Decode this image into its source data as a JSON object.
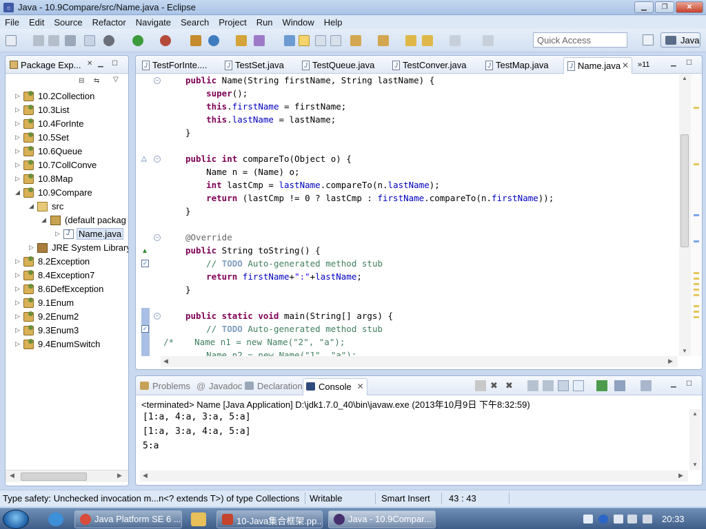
{
  "window": {
    "title": "Java - 10.9Compare/src/Name.java - Eclipse"
  },
  "menu": [
    "File",
    "Edit",
    "Source",
    "Refactor",
    "Navigate",
    "Search",
    "Project",
    "Run",
    "Window",
    "Help"
  ],
  "quick_access": {
    "placeholder": "Quick Access"
  },
  "perspective": {
    "label": "Java"
  },
  "package_explorer": {
    "title": "Package Exp...",
    "tree": [
      {
        "label": "10.2Collection",
        "icon": "project-icon"
      },
      {
        "label": "10.3List",
        "icon": "project-icon"
      },
      {
        "label": "10.4ForInte",
        "icon": "project-icon"
      },
      {
        "label": "10.5Set",
        "icon": "project-icon"
      },
      {
        "label": "10.6Queue",
        "icon": "project-icon"
      },
      {
        "label": "10.7CollConve",
        "icon": "project-icon"
      },
      {
        "label": "10.8Map",
        "icon": "project-icon"
      },
      {
        "label": "10.9Compare",
        "icon": "project-icon"
      },
      {
        "label": "src",
        "icon": "source-folder-icon"
      },
      {
        "label": "(default packag",
        "icon": "package-icon"
      },
      {
        "label": "Name.java",
        "icon": "java-file-icon"
      },
      {
        "label": "JRE System Library",
        "icon": "library-icon"
      },
      {
        "label": "8.2Exception",
        "icon": "project-icon"
      },
      {
        "label": "8.4Exception7",
        "icon": "project-icon"
      },
      {
        "label": "8.6DefException",
        "icon": "project-icon"
      },
      {
        "label": "9.1Enum",
        "icon": "project-icon"
      },
      {
        "label": "9.2Enum2",
        "icon": "project-icon"
      },
      {
        "label": "9.3Enum3",
        "icon": "project-icon"
      },
      {
        "label": "9.4EnumSwitch",
        "icon": "project-icon"
      }
    ]
  },
  "editor": {
    "tabs": [
      "TestForInte....",
      "TestSet.java",
      "TestQueue.java",
      "TestConver.java",
      "TestMap.java",
      "Name.java"
    ],
    "active_tab": "Name.java",
    "overflow": "11"
  },
  "console": {
    "tabs": [
      "Problems",
      "Javadoc",
      "Declaration",
      "Console"
    ],
    "active_tab": "Console",
    "status": "<terminated> Name [Java Application] D:\\jdk1.7.0_40\\bin\\javaw.exe (2013年10月9日 下午8:32:59)",
    "output": [
      "[1:a, 4:a, 3:a, 5:a]",
      "[1:a, 3:a, 4:a, 5:a]",
      "5:a"
    ]
  },
  "statusbar": {
    "message": "Type safety: Unchecked invocation m...n<? extends T>) of type Collections",
    "mode": "Writable",
    "insert": "Smart Insert",
    "position": "43 : 43"
  },
  "taskbar": {
    "items": [
      "Java Platform SE 6 ...",
      "10-Java集合框架.pp...",
      "Java - 10.9Compar..."
    ],
    "clock": "20:33"
  }
}
